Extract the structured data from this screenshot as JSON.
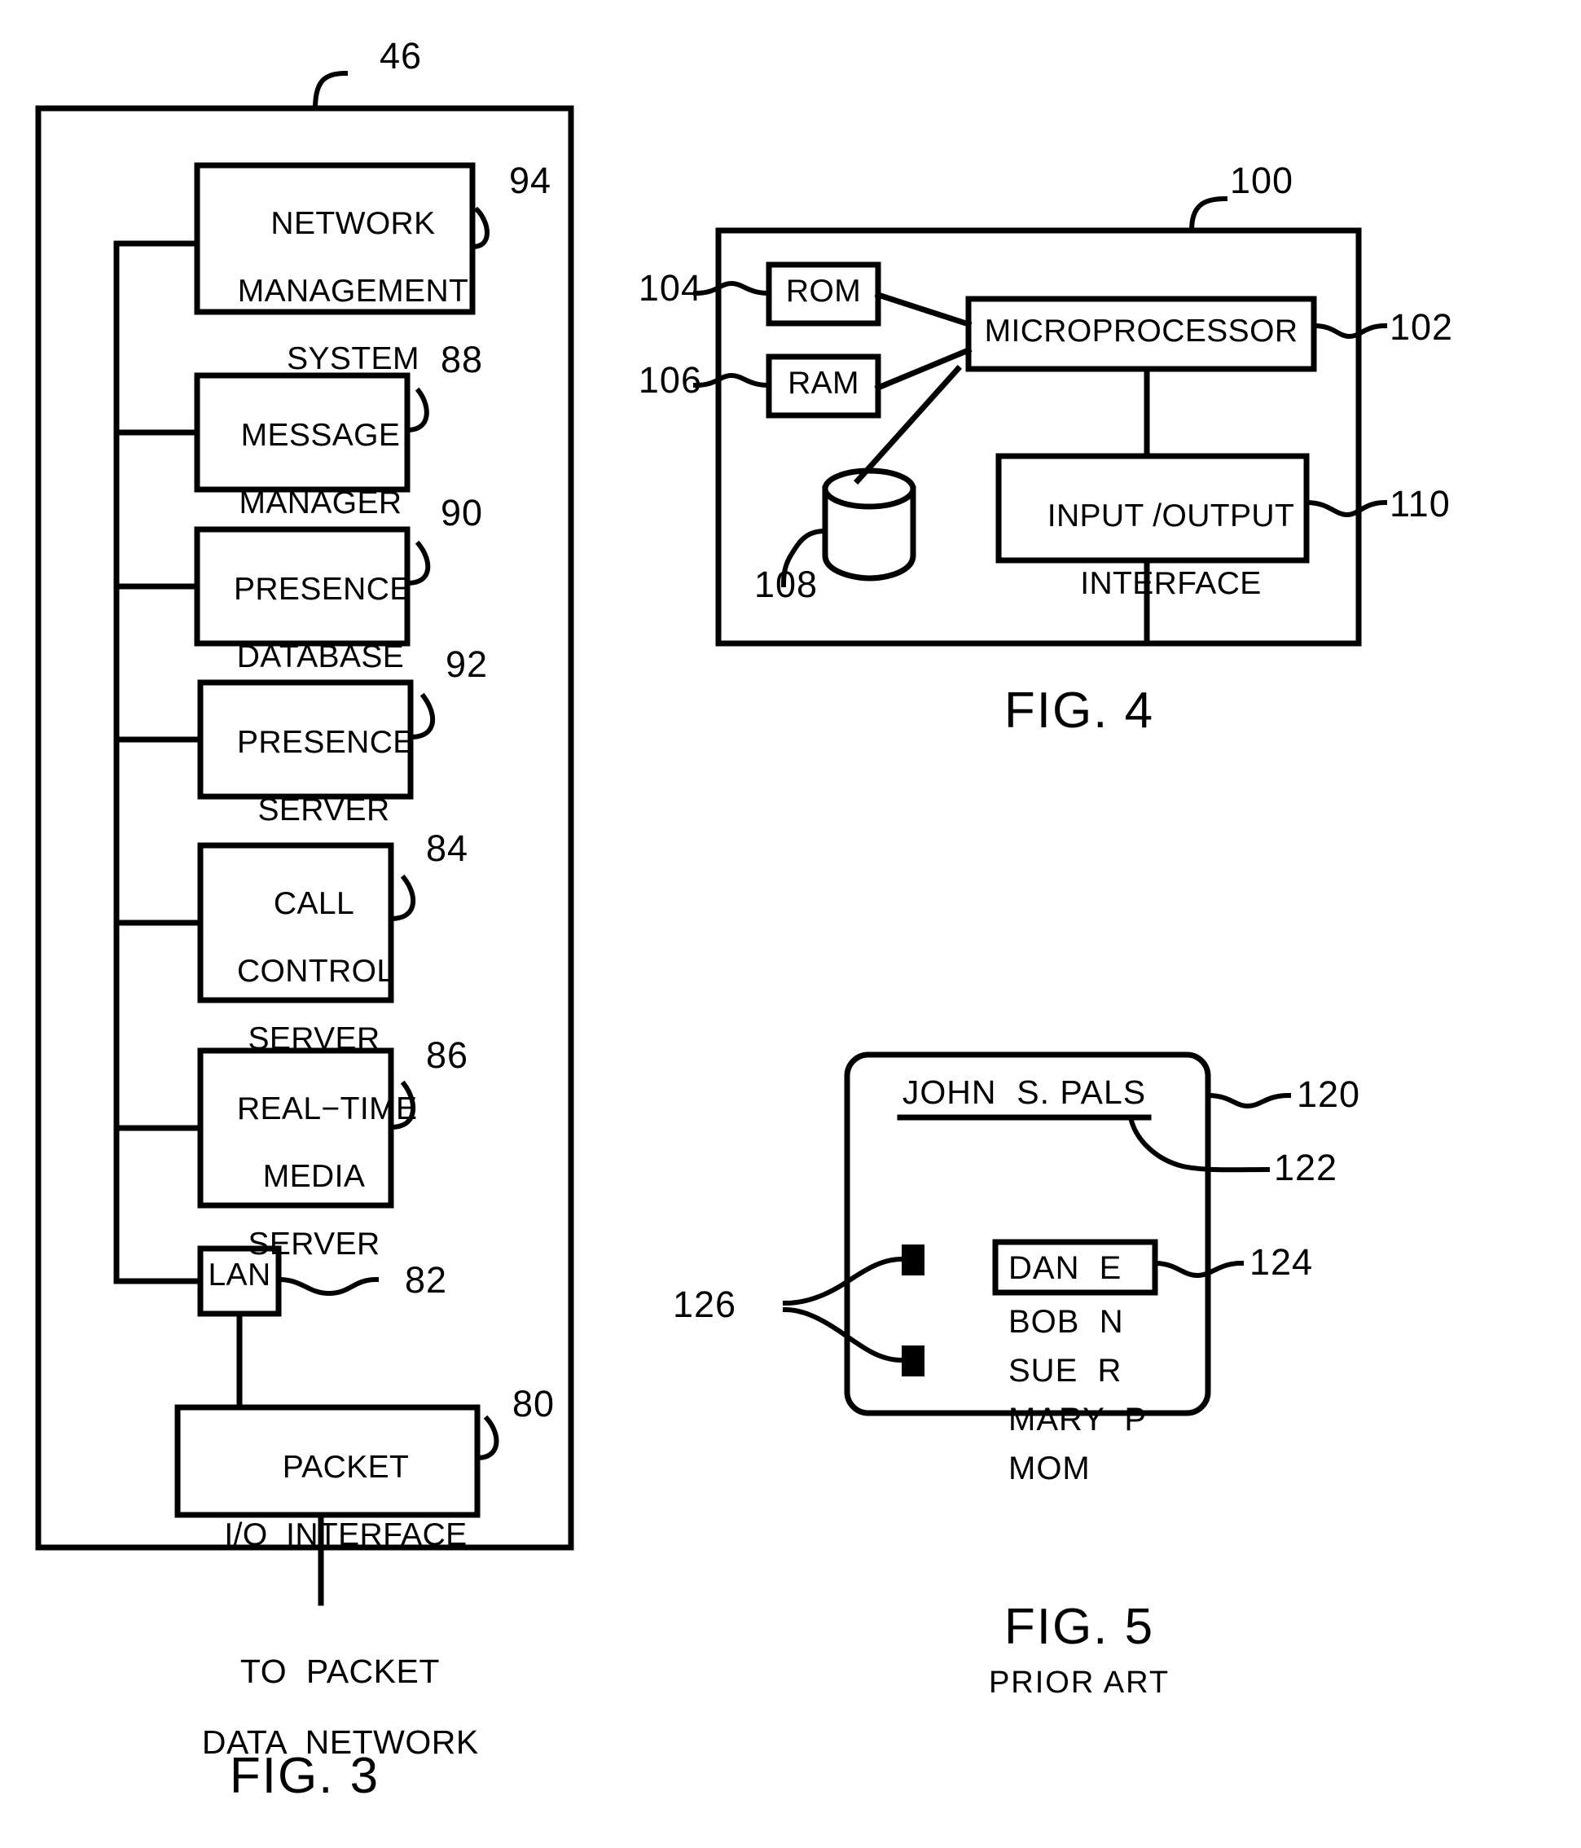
{
  "figures": {
    "fig3": {
      "caption": "FIG. 3",
      "outer_ref": "46",
      "network_note_line1": "TO  PACKET",
      "network_note_line2": "DATA  NETWORK",
      "blocks": [
        {
          "id": "nms",
          "label_lines": [
            "NETWORK",
            "MANAGEMENT",
            "SYSTEM"
          ],
          "ref": "94"
        },
        {
          "id": "msg",
          "label_lines": [
            "MESSAGE",
            "MANAGER"
          ],
          "ref": "88"
        },
        {
          "id": "pdb",
          "label_lines": [
            "PRESENCE",
            "DATABASE"
          ],
          "ref": "90"
        },
        {
          "id": "psrv",
          "label_lines": [
            "PRESENCE",
            "SERVER"
          ],
          "ref": "92"
        },
        {
          "id": "ccs",
          "label_lines": [
            "CALL",
            "CONTROL",
            "SERVER"
          ],
          "ref": "84"
        },
        {
          "id": "rtms",
          "label_lines": [
            "REAL−TIME",
            "MEDIA",
            "SERVER"
          ],
          "ref": "86"
        },
        {
          "id": "lan",
          "label_lines": [
            "LAN"
          ],
          "ref": "82"
        },
        {
          "id": "pio",
          "label_lines": [
            "PACKET",
            "I/O  INTERFACE"
          ],
          "ref": "80"
        }
      ]
    },
    "fig4": {
      "caption": "FIG. 4",
      "outer_ref": "100",
      "blocks": [
        {
          "id": "rom",
          "label_lines": [
            "ROM"
          ],
          "ref": "104"
        },
        {
          "id": "ram",
          "label_lines": [
            "RAM"
          ],
          "ref": "106"
        },
        {
          "id": "cpu",
          "label_lines": [
            "MICROPROCESSOR"
          ],
          "ref": "102"
        },
        {
          "id": "disk",
          "label_lines": [],
          "ref": "108"
        },
        {
          "id": "io",
          "label_lines": [
            "INPUT /OUTPUT",
            "INTERFACE"
          ],
          "ref": "110"
        }
      ]
    },
    "fig5": {
      "caption": "FIG. 5",
      "subcaption": "PRIOR ART",
      "screen_ref": "120",
      "title_ref": "122",
      "highlight_ref": "124",
      "markers_ref": "126",
      "owner_title": "JOHN  S. PALS",
      "buddy_list": [
        {
          "name": "DAN  E",
          "selected": true
        },
        {
          "name": "BOB  N",
          "selected": false
        },
        {
          "name": "SUE  R",
          "selected": false
        },
        {
          "name": "MARY  P",
          "selected": false
        },
        {
          "name": "MOM",
          "selected": false
        }
      ],
      "status_markers": 2
    }
  },
  "colors": {
    "ink": "#000000",
    "paper": "#ffffff"
  }
}
